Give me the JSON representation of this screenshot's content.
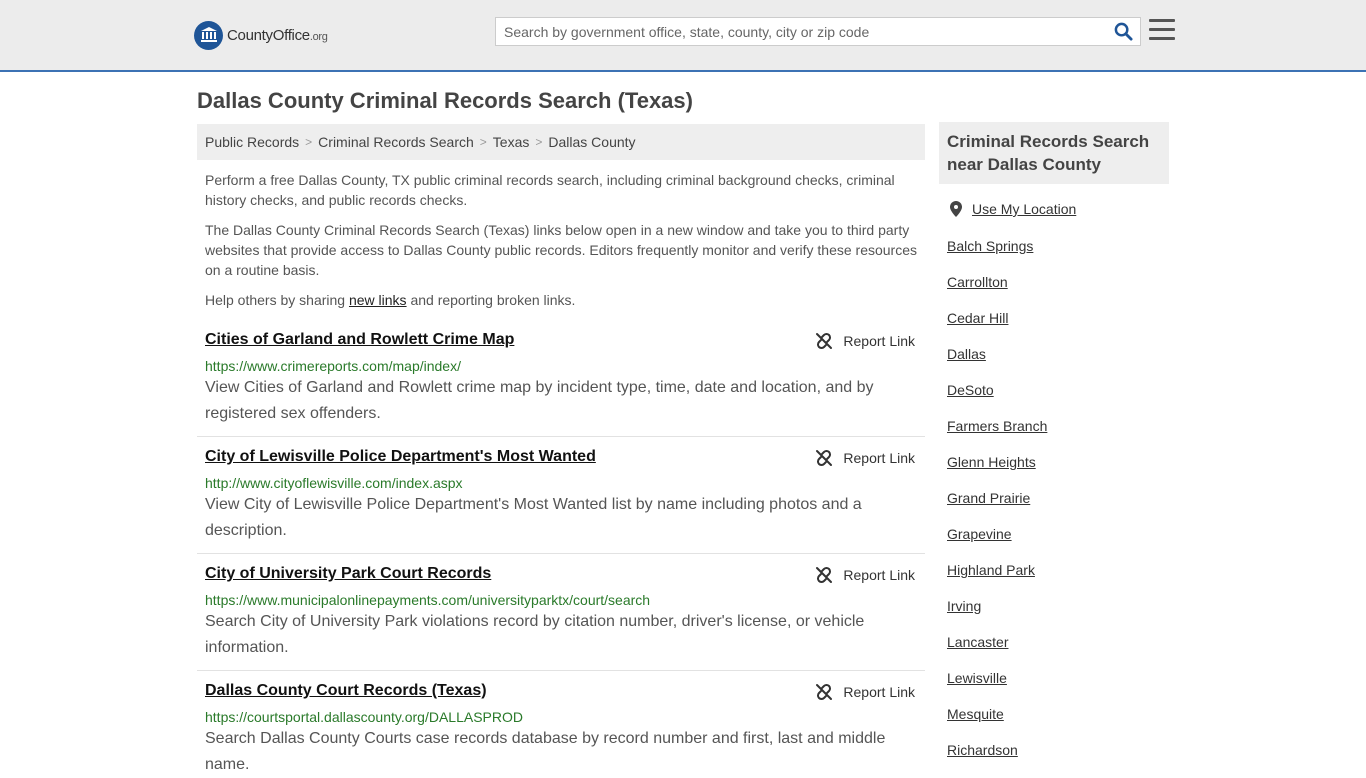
{
  "header": {
    "logo_name": "CountyOffice",
    "logo_tld": ".org",
    "search_placeholder": "Search by government office, state, county, city or zip code"
  },
  "page_title": "Dallas County Criminal Records Search (Texas)",
  "breadcrumb": [
    "Public Records",
    "Criminal Records Search",
    "Texas",
    "Dallas County"
  ],
  "intro": {
    "p1": "Perform a free Dallas County, TX public criminal records search, including criminal background checks, criminal history checks, and public records checks.",
    "p2": "The Dallas County Criminal Records Search (Texas) links below open in a new window and take you to third party websites that provide access to Dallas County public records. Editors frequently monitor and verify these resources on a routine basis.",
    "p3_before": "Help others by sharing ",
    "p3_link": "new links",
    "p3_after": " and reporting broken links."
  },
  "report_label": "Report Link",
  "entries": [
    {
      "title": "Cities of Garland and Rowlett Crime Map",
      "url": "https://www.crimereports.com/map/index/",
      "desc": "View Cities of Garland and Rowlett crime map by incident type, time, date and location, and by registered sex offenders."
    },
    {
      "title": "City of Lewisville Police Department's Most Wanted",
      "url": "http://www.cityoflewisville.com/index.aspx",
      "desc": "View City of Lewisville Police Department's Most Wanted list by name including photos and a description."
    },
    {
      "title": "City of University Park Court Records",
      "url": "https://www.municipalonlinepayments.com/universityparktx/court/search",
      "desc": "Search City of University Park violations record by citation number, driver's license, or vehicle information."
    },
    {
      "title": "Dallas County Court Records (Texas)",
      "url": "https://courtsportal.dallascounty.org/DALLASPROD",
      "desc": "Search Dallas County Courts case records database by record number and first, last and middle name."
    }
  ],
  "sidebar": {
    "heading": "Criminal Records Search near Dallas County",
    "use_location": "Use My Location",
    "cities": [
      "Balch Springs",
      "Carrollton",
      "Cedar Hill",
      "Dallas",
      "DeSoto",
      "Farmers Branch",
      "Glenn Heights",
      "Grand Prairie",
      "Grapevine",
      "Highland Park",
      "Irving",
      "Lancaster",
      "Lewisville",
      "Mesquite",
      "Richardson"
    ]
  },
  "colors": {
    "accent": "#3c72b4",
    "logo": "#1f5597",
    "url_green": "#2a7a2a"
  }
}
